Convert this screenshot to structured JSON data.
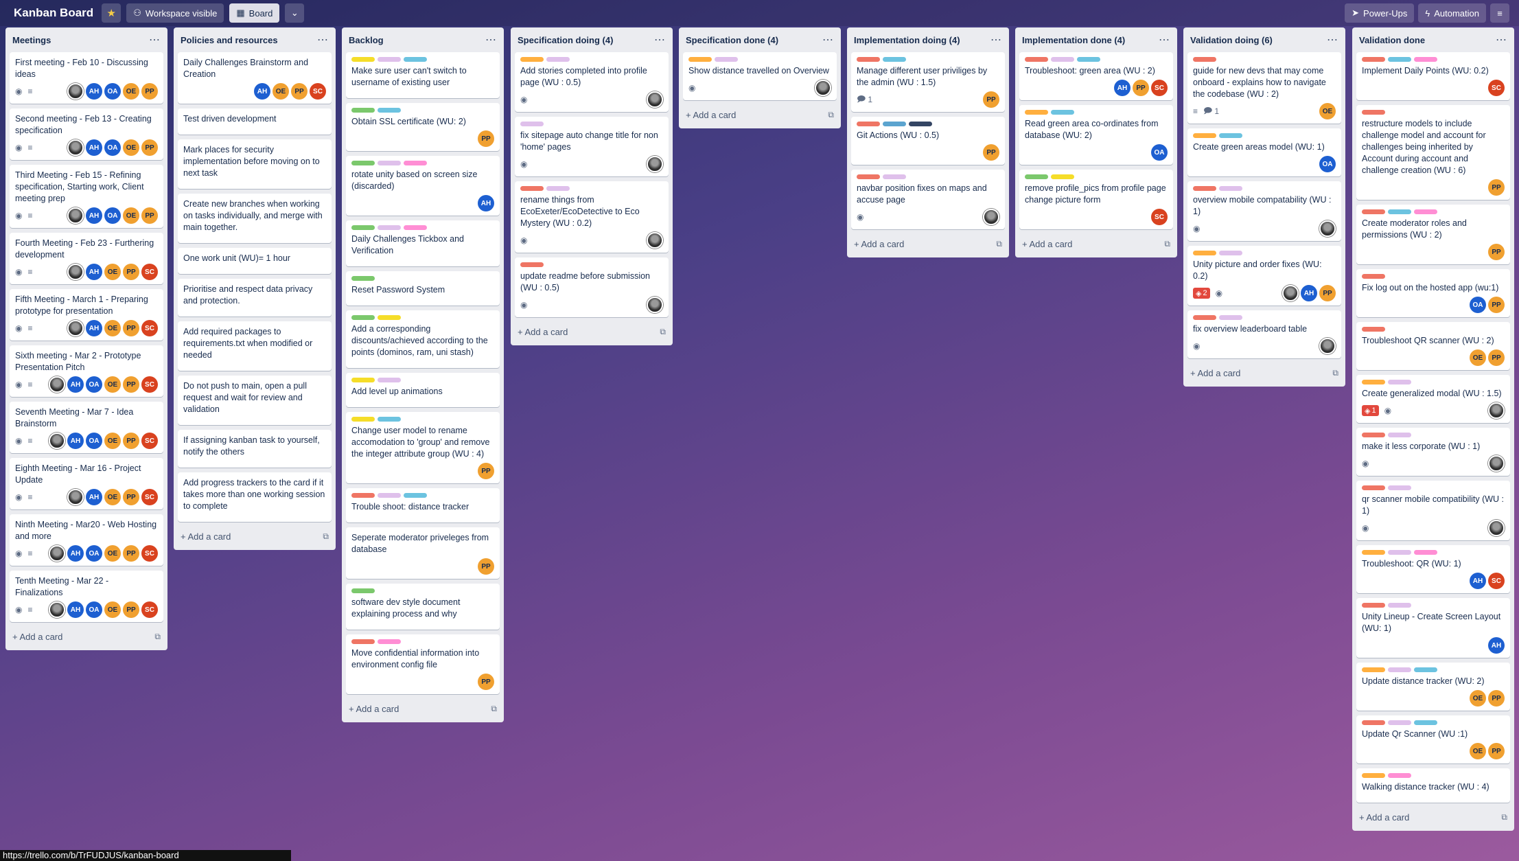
{
  "header": {
    "board_title": "Kanban Board",
    "star_icon": "star-icon",
    "visibility_label": "Workspace visible",
    "view_label": "Board",
    "powerups_label": "Power-Ups",
    "automation_label": "Automation"
  },
  "add_card_label": "Add a card",
  "status_url": "https://trello.com/b/TrFUDJUS/kanban-board",
  "colors": {
    "green": "#7bc86c",
    "yellow": "#f5dd29",
    "orange": "#ffaf3f",
    "red": "#ef7564",
    "purple": "#dfc0eb",
    "pink": "#ff8ed4",
    "sky": "#6cc3e0",
    "blue": "#5ba4cf",
    "black": "#344563"
  },
  "avatars": {
    "AH": "#1d5fd1",
    "OA": "#1d5fd1",
    "OE": "#f0a030",
    "PP": "#f0a030",
    "SC": "#d9421f"
  },
  "lists": [
    {
      "title": "Meetings",
      "cards": [
        {
          "title": "First meeting - Feb 10 - Discussing ideas",
          "labels": [],
          "badges": [
            "watch",
            "desc"
          ],
          "members": [
            "photo",
            "AH",
            "OA",
            "OE",
            "PP"
          ]
        },
        {
          "title": "Second meeting - Feb 13 - Creating specification",
          "labels": [],
          "badges": [
            "watch",
            "desc"
          ],
          "members": [
            "photo",
            "AH",
            "OA",
            "OE",
            "PP"
          ]
        },
        {
          "title": "Third Meeting - Feb 15 - Refining specification, Starting work, Client meeting prep",
          "labels": [],
          "badges": [
            "watch",
            "desc"
          ],
          "members": [
            "photo",
            "AH",
            "OA",
            "OE",
            "PP"
          ]
        },
        {
          "title": "Fourth Meeting - Feb 23 - Furthering development",
          "labels": [],
          "badges": [
            "watch",
            "desc"
          ],
          "members": [
            "photo",
            "AH",
            "OE",
            "PP",
            "SC"
          ]
        },
        {
          "title": "Fifth Meeting - March 1 - Preparing prototype for presentation",
          "labels": [],
          "badges": [
            "watch",
            "desc"
          ],
          "members": [
            "photo",
            "AH",
            "OE",
            "PP",
            "SC"
          ]
        },
        {
          "title": "Sixth meeting - Mar 2 - Prototype Presentation Pitch",
          "labels": [],
          "badges": [
            "watch",
            "desc"
          ],
          "members": [
            "photo",
            "AH",
            "OA",
            "OE",
            "PP",
            "SC"
          ]
        },
        {
          "title": "Seventh Meeting - Mar 7 - Idea Brainstorm",
          "labels": [],
          "badges": [
            "watch",
            "desc"
          ],
          "members": [
            "photo",
            "AH",
            "OA",
            "OE",
            "PP",
            "SC"
          ]
        },
        {
          "title": "Eighth Meeting - Mar 16 - Project Update",
          "labels": [],
          "badges": [
            "watch",
            "desc"
          ],
          "members": [
            "photo",
            "AH",
            "OE",
            "PP",
            "SC"
          ]
        },
        {
          "title": "Ninth Meeting - Mar20 - Web Hosting and more",
          "labels": [],
          "badges": [
            "watch",
            "desc"
          ],
          "members": [
            "photo",
            "AH",
            "OA",
            "OE",
            "PP",
            "SC"
          ]
        },
        {
          "title": "Tenth Meeting - Mar 22 - Finalizations",
          "labels": [],
          "badges": [
            "watch",
            "desc"
          ],
          "members": [
            "photo",
            "AH",
            "OA",
            "OE",
            "PP",
            "SC"
          ]
        }
      ]
    },
    {
      "title": "Policies and resources",
      "cards": [
        {
          "title": "Daily Challenges Brainstorm and Creation",
          "labels": [],
          "badges": [],
          "members": [
            "AH",
            "OE",
            "PP",
            "SC"
          ]
        },
        {
          "title": "Test driven development",
          "labels": [],
          "badges": [],
          "members": []
        },
        {
          "title": "Mark places for security implementation before moving on to next task",
          "labels": [],
          "badges": [],
          "members": []
        },
        {
          "title": "Create new branches when working on tasks individually, and merge with main together.",
          "labels": [],
          "badges": [],
          "members": []
        },
        {
          "title": "One work unit (WU)= 1 hour",
          "labels": [],
          "badges": [],
          "members": []
        },
        {
          "title": "Prioritise and respect data privacy and protection.",
          "labels": [],
          "badges": [],
          "members": []
        },
        {
          "title": "Add required packages to requirements.txt when modified or needed",
          "labels": [],
          "badges": [],
          "members": []
        },
        {
          "title": "Do not push to main, open a pull request and wait for review and validation",
          "labels": [],
          "badges": [],
          "members": []
        },
        {
          "title": "If assigning kanban task to yourself, notify the others",
          "labels": [],
          "badges": [],
          "members": []
        },
        {
          "title": "Add progress trackers to the card if it takes more than one working session to complete",
          "labels": [],
          "badges": [],
          "members": []
        }
      ]
    },
    {
      "title": "Backlog",
      "cards": [
        {
          "title": "Make sure user can't switch to username of existing user",
          "labels": [
            "yellow",
            "purple",
            "sky"
          ],
          "badges": [],
          "members": []
        },
        {
          "title": "Obtain SSL certificate (WU: 2)",
          "labels": [
            "green",
            "sky"
          ],
          "badges": [],
          "members": [
            "PP"
          ]
        },
        {
          "title": "rotate unity based on screen size (discarded)",
          "labels": [
            "green",
            "purple",
            "pink"
          ],
          "badges": [],
          "members": [
            "AH"
          ]
        },
        {
          "title": "Daily Challenges Tickbox and Verification",
          "labels": [
            "green",
            "purple",
            "pink"
          ],
          "badges": [],
          "members": []
        },
        {
          "title": "Reset Password System",
          "labels": [
            "green"
          ],
          "badges": [],
          "members": []
        },
        {
          "title": "Add a corresponding discounts/achieved according to the points (dominos, ram, uni stash)",
          "labels": [
            "green",
            "yellow"
          ],
          "badges": [],
          "members": []
        },
        {
          "title": "Add level up animations",
          "labels": [
            "yellow",
            "purple"
          ],
          "badges": [],
          "members": []
        },
        {
          "title": "Change user model to rename accomodation to 'group' and remove the integer attribute group (WU : 4)",
          "labels": [
            "yellow",
            "sky"
          ],
          "badges": [],
          "members": [
            "PP"
          ]
        },
        {
          "title": "Trouble shoot: distance tracker",
          "labels": [
            "red",
            "purple",
            "sky"
          ],
          "badges": [],
          "members": []
        },
        {
          "title": "Seperate moderator priveleges from database",
          "labels": [],
          "badges": [],
          "members": [
            "PP"
          ]
        },
        {
          "title": "software dev style document explaining process and why",
          "labels": [
            "green"
          ],
          "badges": [],
          "members": []
        },
        {
          "title": "Move confidential information into environment config file",
          "labels": [
            "red",
            "pink"
          ],
          "badges": [],
          "members": [
            "PP"
          ]
        }
      ]
    },
    {
      "title": "Specification doing (4)",
      "cards": [
        {
          "title": "Add stories completed into profile page (WU : 0.5)",
          "labels": [
            "orange",
            "purple"
          ],
          "badges": [
            "watch"
          ],
          "members": [
            "photo"
          ]
        },
        {
          "title": "fix sitepage auto change title for non 'home' pages",
          "labels": [
            "purple"
          ],
          "badges": [
            "watch"
          ],
          "members": [
            "photo"
          ]
        },
        {
          "title": "rename things from EcoExeter/EcoDetective to Eco Mystery (WU : 0.2)",
          "labels": [
            "red",
            "purple"
          ],
          "badges": [
            "watch"
          ],
          "members": [
            "photo"
          ]
        },
        {
          "title": "update readme before submission (WU : 0.5)",
          "labels": [
            "red"
          ],
          "badges": [
            "watch"
          ],
          "members": [
            "photo"
          ]
        }
      ]
    },
    {
      "title": "Specification done (4)",
      "cards": [
        {
          "title": "Show distance travelled on Overview",
          "labels": [
            "orange",
            "purple"
          ],
          "badges": [
            "watch"
          ],
          "members": [
            "photo"
          ]
        }
      ]
    },
    {
      "title": "Implementation doing (4)",
      "cards": [
        {
          "title": "Manage different user priviliges by the admin (WU : 1.5)",
          "labels": [
            "red",
            "sky"
          ],
          "badges": [
            "comment:1"
          ],
          "members": [
            "PP"
          ]
        },
        {
          "title": "Git Actions (WU : 0.5)",
          "labels": [
            "red",
            "blue",
            "black"
          ],
          "badges": [],
          "members": [
            "PP"
          ]
        },
        {
          "title": "navbar position fixes on maps and accuse page",
          "labels": [
            "red",
            "purple"
          ],
          "badges": [
            "watch"
          ],
          "members": [
            "photo"
          ]
        }
      ]
    },
    {
      "title": "Implementation done (4)",
      "cards": [
        {
          "title": "Troubleshoot: green area (WU : 2)",
          "labels": [
            "red",
            "purple",
            "sky"
          ],
          "badges": [],
          "members": [
            "AH",
            "PP",
            "SC"
          ]
        },
        {
          "title": "Read green area co-ordinates from database (WU: 2)",
          "labels": [
            "orange",
            "sky"
          ],
          "badges": [],
          "members": [
            "OA"
          ]
        },
        {
          "title": "remove profile_pics from profile page change picture form",
          "labels": [
            "green",
            "yellow"
          ],
          "badges": [],
          "members": [
            "SC"
          ]
        }
      ]
    },
    {
      "title": "Validation doing (6)",
      "cards": [
        {
          "title": "guide for new devs that may come onboard - explains how to navigate the codebase (WU : 2)",
          "labels": [
            "red"
          ],
          "badges": [
            "desc",
            "comment:1"
          ],
          "members": [
            "OE"
          ]
        },
        {
          "title": "Create green areas model (WU: 1)",
          "labels": [
            "orange",
            "sky"
          ],
          "badges": [],
          "members": [
            "OA"
          ]
        },
        {
          "title": "overview mobile compatability (WU : 1)",
          "labels": [
            "red",
            "purple"
          ],
          "badges": [
            "watch"
          ],
          "members": [
            "photo"
          ]
        },
        {
          "title": "Unity picture and order fixes (WU: 0.2)",
          "labels": [
            "orange",
            "purple"
          ],
          "badges": [
            "alert:2",
            "watch"
          ],
          "members": [
            "photo",
            "AH",
            "PP"
          ]
        },
        {
          "title": "fix overview leaderboard table",
          "labels": [
            "red",
            "purple"
          ],
          "badges": [
            "watch"
          ],
          "members": [
            "photo"
          ]
        }
      ]
    },
    {
      "title": "Validation done",
      "cards": [
        {
          "title": "Implement Daily Points (WU: 0.2)",
          "labels": [
            "red",
            "sky",
            "pink"
          ],
          "badges": [],
          "members": [
            "SC"
          ]
        },
        {
          "title": "restructure models to include challenge model and account for challenges being inherited by Account during account and challenge creation (WU : 6)",
          "labels": [
            "red"
          ],
          "badges": [],
          "members": [
            "PP"
          ]
        },
        {
          "title": "Create moderator roles and permissions (WU : 2)",
          "labels": [
            "red",
            "sky",
            "pink"
          ],
          "badges": [],
          "members": [
            "PP"
          ]
        },
        {
          "title": "Fix log out on the hosted app (wu:1)",
          "labels": [
            "red"
          ],
          "badges": [],
          "members": [
            "OA",
            "PP"
          ]
        },
        {
          "title": "Troubleshoot QR scanner (WU : 2)",
          "labels": [
            "red"
          ],
          "badges": [],
          "members": [
            "OE",
            "PP"
          ]
        },
        {
          "title": "Create generalized modal (WU : 1.5)",
          "labels": [
            "orange",
            "purple"
          ],
          "badges": [
            "alert:1",
            "watch"
          ],
          "members": [
            "photo"
          ]
        },
        {
          "title": "make it less corporate (WU : 1)",
          "labels": [
            "red",
            "purple"
          ],
          "badges": [
            "watch"
          ],
          "members": [
            "photo"
          ]
        },
        {
          "title": "qr scanner mobile compatibility (WU : 1)",
          "labels": [
            "red",
            "purple"
          ],
          "badges": [
            "watch"
          ],
          "members": [
            "photo"
          ]
        },
        {
          "title": "Troubleshoot: QR (WU: 1)",
          "labels": [
            "orange",
            "purple",
            "pink"
          ],
          "badges": [],
          "members": [
            "AH",
            "SC"
          ]
        },
        {
          "title": "Unity Lineup - Create Screen Layout (WU: 1)",
          "labels": [
            "red",
            "purple"
          ],
          "badges": [],
          "members": [
            "AH"
          ]
        },
        {
          "title": "Update distance tracker (WU: 2)",
          "labels": [
            "orange",
            "purple",
            "sky"
          ],
          "badges": [],
          "members": [
            "OE",
            "PP"
          ]
        },
        {
          "title": "Update Qr Scanner (WU :1)",
          "labels": [
            "red",
            "purple",
            "sky"
          ],
          "badges": [],
          "members": [
            "OE",
            "PP"
          ]
        },
        {
          "title": "Walking distance tracker (WU : 4)",
          "labels": [
            "orange",
            "pink"
          ],
          "badges": [],
          "members": []
        }
      ]
    }
  ]
}
